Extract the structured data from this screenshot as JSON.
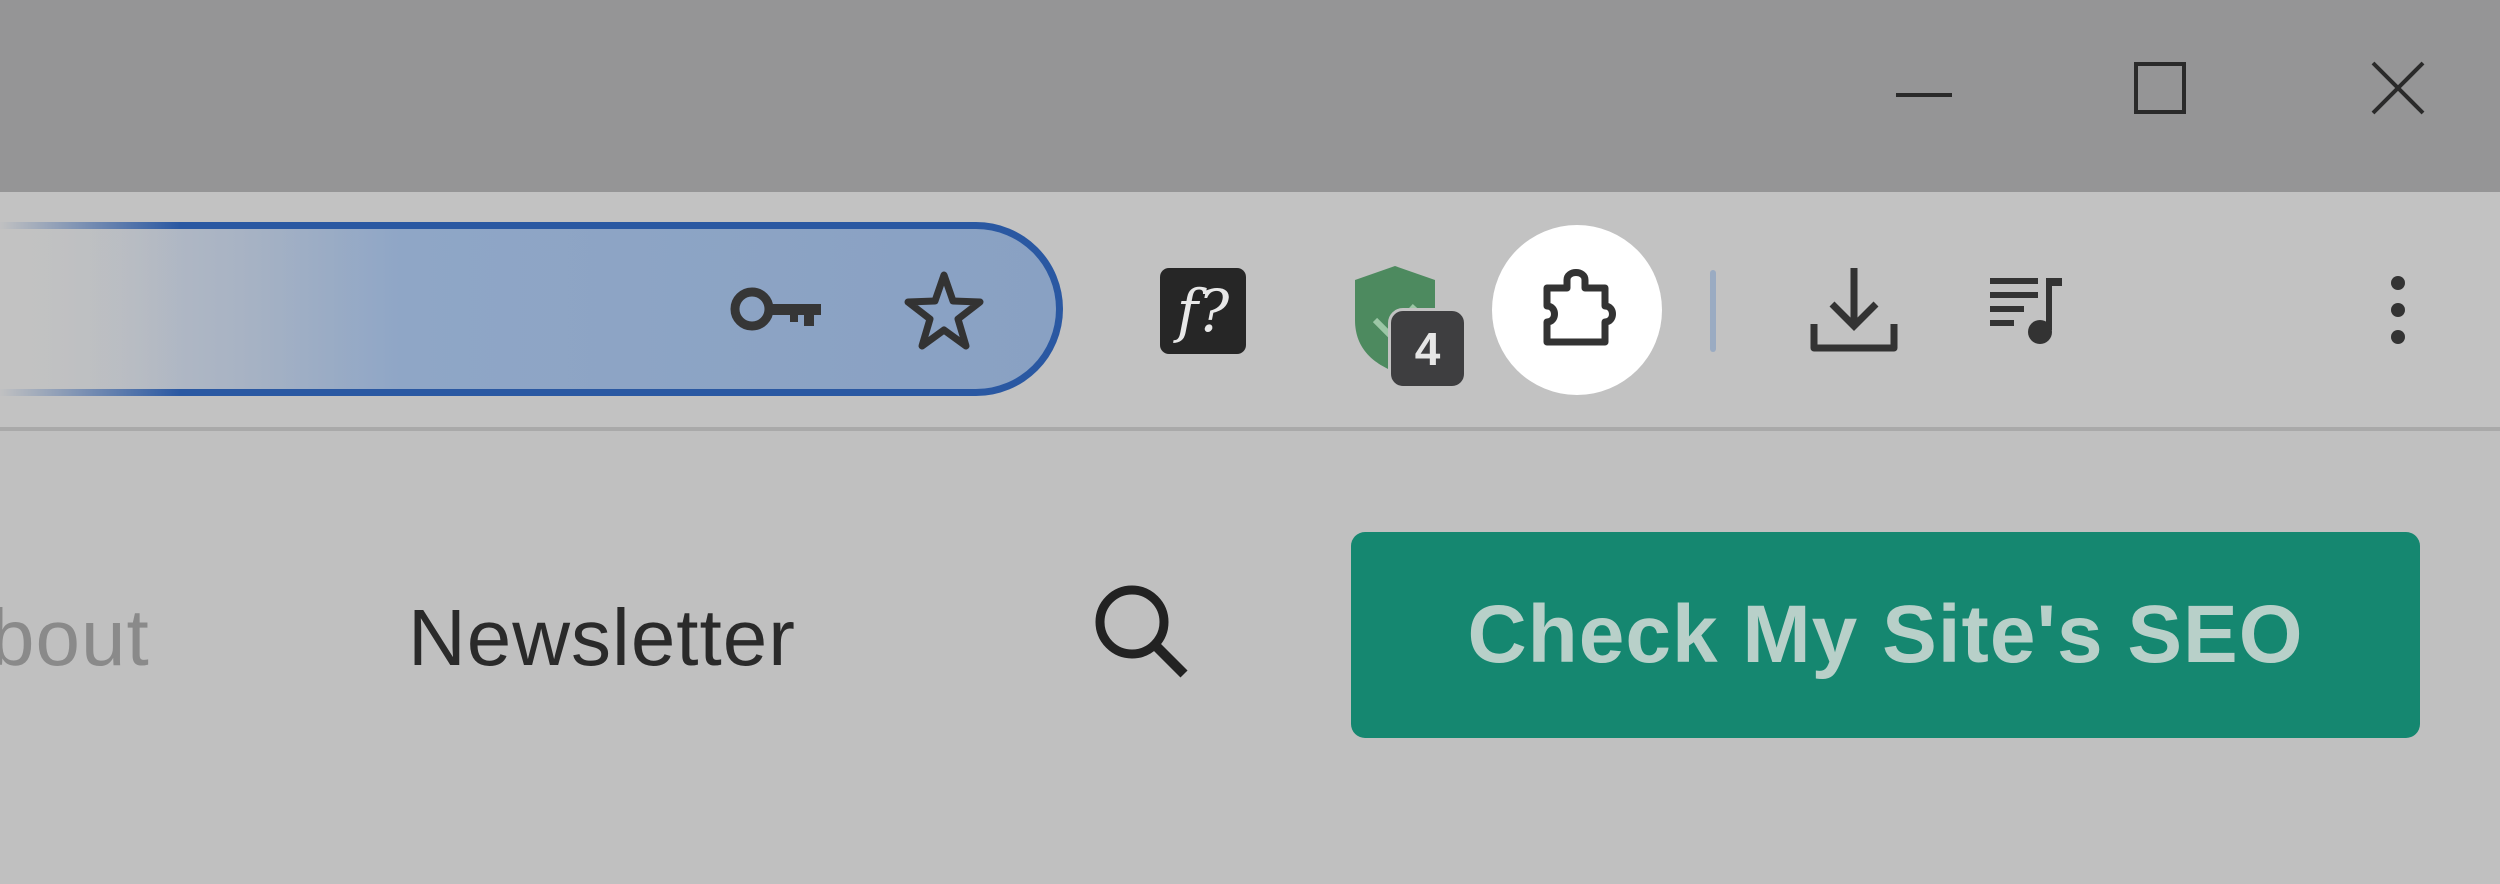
{
  "window_controls": {
    "minimize": "minimize",
    "maximize": "maximize",
    "close": "close"
  },
  "toolbar": {
    "omnibox_icons": [
      "key-icon",
      "star-icon"
    ],
    "extensions": [
      {
        "name": "f-question-extension",
        "label": "f?"
      },
      {
        "name": "shield-check-extension",
        "badge": "4"
      },
      {
        "name": "puzzle-extensions-menu",
        "highlighted": true
      }
    ],
    "right_icons": [
      "download-icon",
      "media-playlist-icon",
      "more-vert-icon"
    ]
  },
  "page": {
    "nav": {
      "about": "bout",
      "newsletter": "Newsletter"
    },
    "cta_label": "Check My Site's SEO"
  },
  "colors": {
    "omnibox_border": "#2a58a2",
    "cta_background": "#158770",
    "shield_green": "#4d8a5f",
    "badge_background": "#3e3e40"
  }
}
